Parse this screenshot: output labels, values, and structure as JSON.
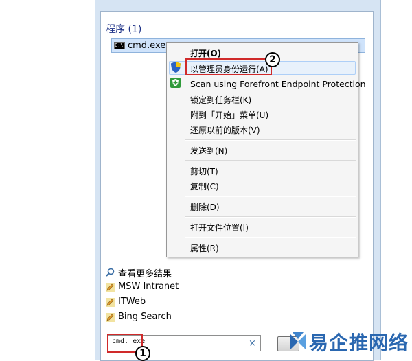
{
  "section": {
    "title": "程序 (1)"
  },
  "result": {
    "icon": "cmd-icon",
    "label": "cmd.exe"
  },
  "menu": {
    "items": [
      {
        "label": "打开(O)"
      },
      {
        "label": "以管理员身份运行(A)"
      },
      {
        "label": "Scan using Forefront Endpoint Protection"
      },
      {
        "label": "锁定到任务栏(K)"
      },
      {
        "label": "附到「开始」菜单(U)"
      },
      {
        "label": "还原以前的版本(V)"
      },
      {
        "label": "发送到(N)"
      },
      {
        "label": "剪切(T)"
      },
      {
        "label": "复制(C)"
      },
      {
        "label": "删除(D)"
      },
      {
        "label": "打开文件位置(I)"
      },
      {
        "label": "属性(R)"
      }
    ]
  },
  "links": [
    {
      "icon": "search-icon",
      "label": "查看更多结果"
    },
    {
      "icon": "pencil-icon",
      "label": "MSW Intranet"
    },
    {
      "icon": "pencil-icon",
      "label": "ITWeb"
    },
    {
      "icon": "pencil-icon",
      "label": "Bing Search"
    }
  ],
  "search": {
    "value": "cmd. exe",
    "clear": "×"
  },
  "annotations": {
    "step1": "1",
    "step2": "2"
  },
  "watermark": {
    "text": "易企推网络"
  },
  "colors": {
    "highlight_border": "#d02a2a",
    "title": "#1e3287",
    "selection": "#cfe3fb"
  }
}
